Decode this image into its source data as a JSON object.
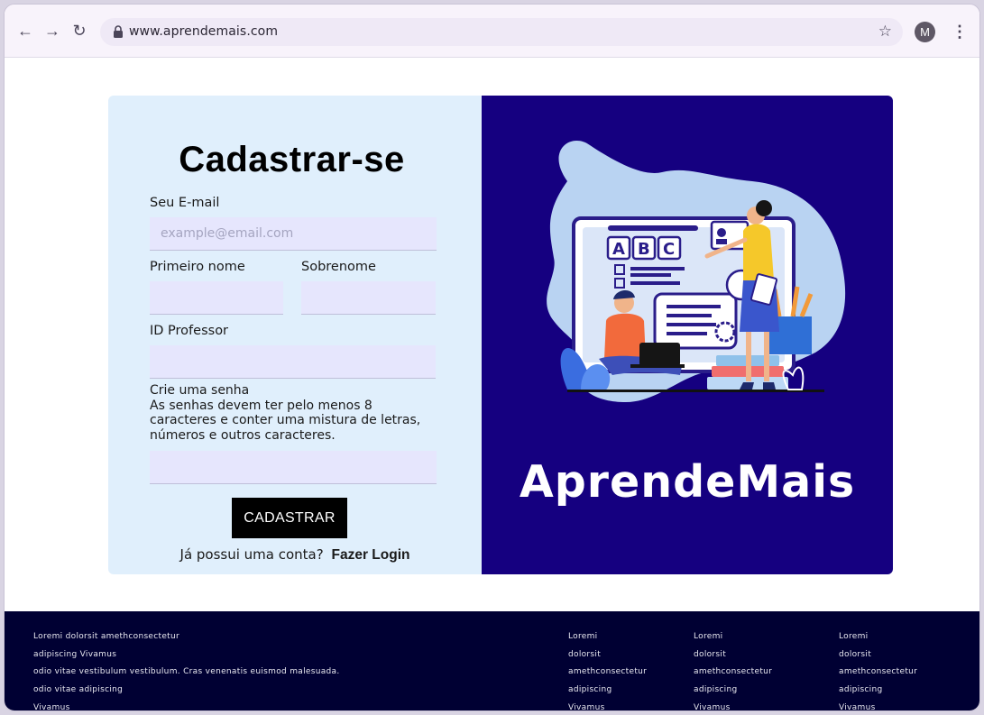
{
  "browser": {
    "url": "www.aprendemais.com",
    "avatar_letter": "M"
  },
  "form": {
    "title": "Cadastrar-se",
    "email_label": "Seu E-mail",
    "email_placeholder": "example@email.com",
    "first_name_label": "Primeiro nome",
    "last_name_label": "Sobrenome",
    "professor_id_label": "ID Professor",
    "password_label": "Crie uma senha",
    "password_hint": "As senhas devem ter pelo menos 8 caracteres e conter uma mistura de letras, números e outros caracteres.",
    "submit_label": "CADASTRAR",
    "have_account_text": "Já possui uma conta?",
    "login_link": "Fazer Login"
  },
  "hero": {
    "brand": "AprendeMais",
    "board_letters": [
      "A",
      "B",
      "C"
    ],
    "colors": {
      "panel": "#150080",
      "blob": "#b9d3f2"
    }
  },
  "footer": {
    "col1": [
      "Loremi dolorsit amethconsectetur",
      "adipiscing Vivamus",
      "odio vitae vestibulum vestibulum. Cras venenatis euismod malesuada.",
      "odio vitae adipiscing",
      "Vivamus"
    ],
    "col2": [
      "Loremi",
      "dolorsit",
      "amethconsectetur",
      "adipiscing",
      "Vivamus"
    ],
    "col3": [
      "Loremi",
      "dolorsit",
      "amethconsectetur",
      "adipiscing",
      "Vivamus"
    ],
    "col4": [
      "Loremi",
      "dolorsit",
      "amethconsectetur",
      "adipiscing",
      "Vivamus"
    ]
  }
}
